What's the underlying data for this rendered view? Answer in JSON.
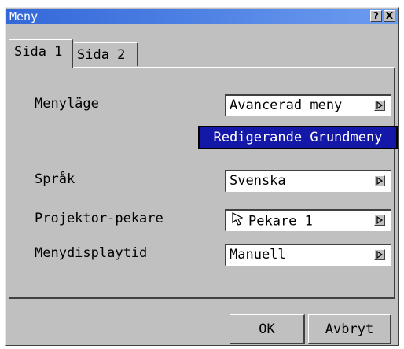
{
  "window": {
    "title": "Meny",
    "help_label": "?",
    "close_label": "X"
  },
  "tabs": [
    {
      "label": "Sida 1"
    },
    {
      "label": "Sida 2"
    }
  ],
  "page1": {
    "menu_mode": {
      "label": "Menyläge",
      "value": "Avancerad meny"
    },
    "edit_basic_menu_label": "Redigerande Grundmeny",
    "language": {
      "label": "Språk",
      "value": "Svenska"
    },
    "projector_pointer": {
      "label": "Projektor-pekare",
      "value": "Pekare 1",
      "icon": "pointer-arrow-icon"
    },
    "menu_display_time": {
      "label": "Menydisplaytid",
      "value": "Manuell"
    }
  },
  "footer": {
    "ok_label": "OK",
    "cancel_label": "Avbryt"
  },
  "colors": {
    "titlebar_start": "#3468d8",
    "titlebar_end": "#6c9cf0",
    "accent_button": "#1418a8",
    "dialog_bg": "#c0c0c0"
  }
}
